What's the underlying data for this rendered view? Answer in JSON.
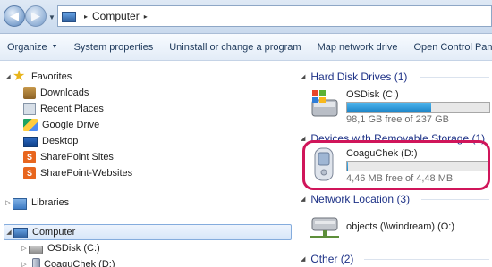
{
  "address_bar": {
    "breadcrumb": "Computer",
    "separator": "▸"
  },
  "command_bar": {
    "organize": "Organize",
    "system_properties": "System properties",
    "uninstall": "Uninstall or change a program",
    "map_network_drive": "Map network drive",
    "open_control_panel": "Open Control Pane"
  },
  "nav_pane": {
    "favorites": "Favorites",
    "downloads": "Downloads",
    "recent_places": "Recent Places",
    "google_drive": "Google Drive",
    "desktop": "Desktop",
    "sharepoint_sites": "SharePoint Sites",
    "sharepoint_websites": "SharePoint-Websites",
    "libraries": "Libraries",
    "computer": "Computer",
    "osdisk": "OSDisk (C:)",
    "coaguchek": "CoaguChek (D:)"
  },
  "content": {
    "hard_disk_header": "Hard Disk Drives (1)",
    "removable_header": "Devices with Removable Storage (1)",
    "network_header": "Network Location (3)",
    "other_header": "Other (2)",
    "osdisk": {
      "name": "OSDisk (C:)",
      "free": "98,1 GB free of 237 GB",
      "used_fraction": 0.59
    },
    "coaguchek": {
      "name": "CoaguChek (D:)",
      "free": "4,46 MB free of 4,48 MB",
      "used_fraction": 0.005
    },
    "network_item": "objects (\\\\windream) (O:)"
  },
  "colors": {
    "highlight": "#d0155a",
    "group_header": "#1e3287",
    "bar_fill": "#1f87c9"
  }
}
